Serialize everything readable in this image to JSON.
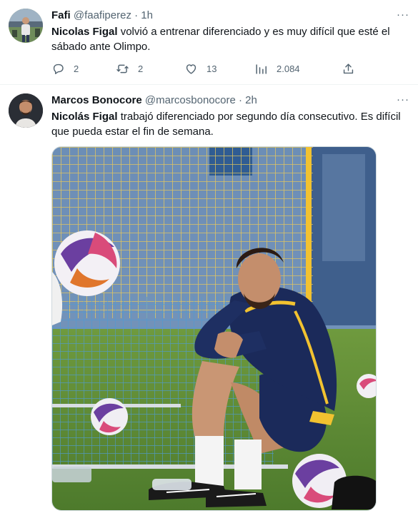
{
  "tweets": [
    {
      "name": "Fafi",
      "handle": "@faafiperez",
      "time": "1h",
      "text_bold": "Nicolas Figal",
      "text_rest": " volvió a entrenar diferenciado y es muy difícil que esté el sábado ante Olimpo.",
      "more_label": "···",
      "actions": {
        "replies": "2",
        "retweets": "2",
        "likes": "13",
        "views": "2.084"
      }
    },
    {
      "name": "Marcos Bonocore",
      "handle": "@marcosbonocore",
      "time": "2h",
      "text_bold": "Nicolás Figal",
      "text_rest": " trabajó diferenciado por segundo día consecutivo. Es difícil que pueda estar el fin de semana.",
      "more_label": "···"
    }
  ],
  "separator": " · ",
  "colors": {
    "text": "#0f1419",
    "secondary": "#536471",
    "border": "#eff3f4",
    "jersey": "#1b2a5a",
    "jersey_stripe": "#f2c230"
  },
  "icons": [
    "reply-icon",
    "retweet-icon",
    "like-icon",
    "views-icon",
    "share-icon",
    "more-icon"
  ]
}
